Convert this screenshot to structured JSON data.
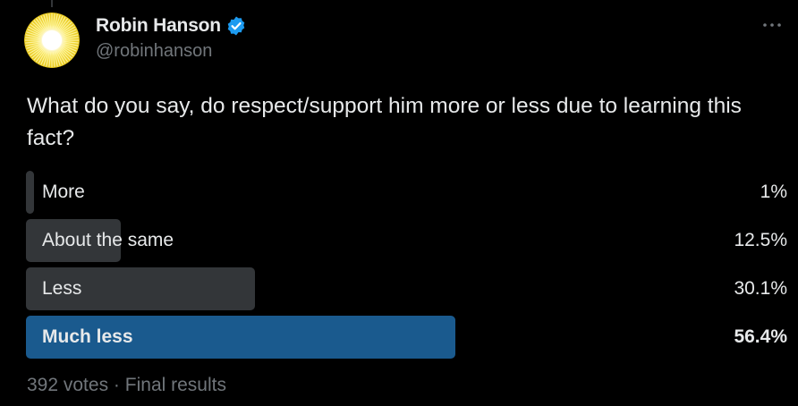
{
  "author": {
    "display_name": "Robin Hanson",
    "handle": "@robinhanson",
    "verified_icon": "verified-badge-icon",
    "avatar_icon": "sun-avatar-icon"
  },
  "tweet": {
    "text": "What do you say, do respect/support him more or less due to learning this fact?"
  },
  "poll": {
    "options": [
      {
        "label": "More",
        "percent_text": "1%",
        "percent": 1,
        "winner": false
      },
      {
        "label": "About the same",
        "percent_text": "12.5%",
        "percent": 12.5,
        "winner": false
      },
      {
        "label": "Less",
        "percent_text": "30.1%",
        "percent": 30.1,
        "winner": false
      },
      {
        "label": "Much less",
        "percent_text": "56.4%",
        "percent": 56.4,
        "winner": true
      }
    ],
    "votes": "392 votes",
    "separator": "·",
    "status": "Final results"
  },
  "colors": {
    "background": "#000000",
    "text": "#e7e9ea",
    "muted": "#71767b",
    "bar": "#333639",
    "winner_bar": "#1a5a8e",
    "verified": "#1d9bf0"
  },
  "menu_icon": "more-dots-icon"
}
